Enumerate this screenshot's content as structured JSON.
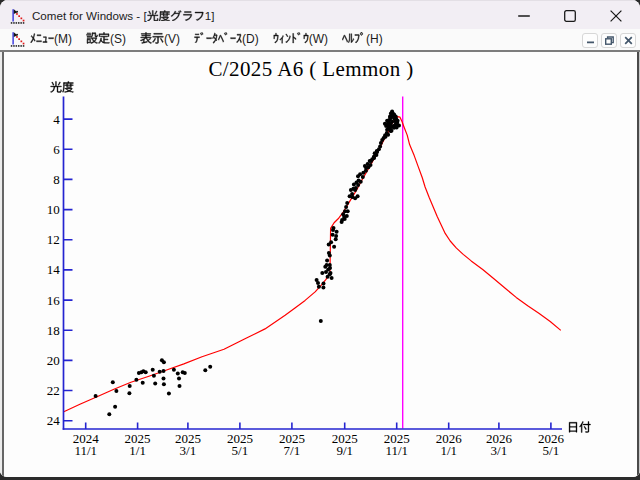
{
  "window": {
    "title": "Comet for Windows - [光度グラフ1]",
    "app_icon": "comet-lightcurve-icon"
  },
  "menu": {
    "items": [
      {
        "id": "menu",
        "label": "ﾒﾆｭｰ(M)"
      },
      {
        "id": "settings",
        "label": "設定(S)"
      },
      {
        "id": "view",
        "label": "表示(V)"
      },
      {
        "id": "database",
        "label": "ﾃﾞｰﾀﾍﾞｰｽ(D)"
      },
      {
        "id": "window",
        "label": "ｳｨﾝﾄﾞｳ(W)"
      },
      {
        "id": "help",
        "label": "ﾍﾙﾌﾟ(H)"
      }
    ]
  },
  "chart_data": {
    "type": "scatter",
    "title": "C/2025 A6 ( Lemmon )",
    "ylabel": "光度",
    "xlabel": "日付",
    "x_epoch": "2024-11-01",
    "xlim_days": [
      -26,
      559
    ],
    "ylim": [
      2.5,
      24.55
    ],
    "y_inverted": true,
    "grid": false,
    "axis_color": "#2424d0",
    "xticks": [
      {
        "day": 0,
        "label": [
          "2024",
          "11/1"
        ]
      },
      {
        "day": 61,
        "label": [
          "2025",
          "1/1"
        ]
      },
      {
        "day": 120,
        "label": [
          "2025",
          "3/1"
        ]
      },
      {
        "day": 181,
        "label": [
          "2025",
          "5/1"
        ]
      },
      {
        "day": 242,
        "label": [
          "2025",
          "7/1"
        ]
      },
      {
        "day": 304,
        "label": [
          "2025",
          "9/1"
        ]
      },
      {
        "day": 365,
        "label": [
          "2025",
          "11/1"
        ]
      },
      {
        "day": 426,
        "label": [
          "2026",
          "1/1"
        ]
      },
      {
        "day": 485,
        "label": [
          "2026",
          "3/1"
        ]
      },
      {
        "day": 546,
        "label": [
          "2026",
          "5/1"
        ]
      }
    ],
    "yticks": [
      4,
      6,
      8,
      10,
      12,
      14,
      16,
      18,
      20,
      22,
      24
    ],
    "perihelion_line": {
      "day": 372,
      "color": "#ff00ff"
    },
    "series": [
      {
        "name": "observations",
        "type": "scatter",
        "color": "#000000",
        "points": [
          [
            11.7,
            22.36
          ],
          [
            27.8,
            23.57
          ],
          [
            31.9,
            21.45
          ],
          [
            34.6,
            23.07
          ],
          [
            36.1,
            22.03
          ],
          [
            51.3,
            22.18
          ],
          [
            51.7,
            21.7
          ],
          [
            59.5,
            21.28
          ],
          [
            62.5,
            20.84
          ],
          [
            65.4,
            20.79
          ],
          [
            66.9,
            21.48
          ],
          [
            67.8,
            20.72
          ],
          [
            70.5,
            20.79
          ],
          [
            78.7,
            20.62
          ],
          [
            80.1,
            21.02
          ],
          [
            81.6,
            21.54
          ],
          [
            86.9,
            20.75
          ],
          [
            89.5,
            19.99
          ],
          [
            91.8,
            20.13
          ],
          [
            91.3,
            20.71
          ],
          [
            91.3,
            21.21
          ],
          [
            91.8,
            21.58
          ],
          [
            97.7,
            22.2
          ],
          [
            103.6,
            20.62
          ],
          [
            108.1,
            20.87
          ],
          [
            109.5,
            21.21
          ],
          [
            110.1,
            21.7
          ],
          [
            113.9,
            20.79
          ],
          [
            116.3,
            20.84
          ],
          [
            140.4,
            20.66
          ],
          [
            146.2,
            20.42
          ],
          [
            275.9,
            17.39
          ],
          [
            271.0,
            14.66
          ],
          [
            273.7,
            15.12
          ],
          [
            277.7,
            14.21
          ],
          [
            279.1,
            14.91
          ],
          [
            279.0,
            15.16
          ],
          [
            281.2,
            13.79
          ],
          [
            282.8,
            13.67
          ],
          [
            283.3,
            13.37
          ],
          [
            283.9,
            14.46
          ],
          [
            284.6,
            13.98
          ],
          [
            286.5,
            13.67
          ],
          [
            286.5,
            14.29
          ],
          [
            286.5,
            13.05
          ],
          [
            285.5,
            12.87
          ],
          [
            287.3,
            14.21
          ],
          [
            288.6,
            14.54
          ],
          [
            285.2,
            12.31
          ],
          [
            288.0,
            12.17
          ],
          [
            289.8,
            11.67
          ],
          [
            290.9,
            11.23
          ],
          [
            291.6,
            12.47
          ],
          [
            293.4,
            11.97
          ],
          [
            294.5,
            11.47
          ],
          [
            300.4,
            10.83
          ],
          [
            302.2,
            10.31
          ],
          [
            304.0,
            10.63
          ],
          [
            306.4,
            10.43
          ],
          [
            307.5,
            10.11
          ],
          [
            304.4,
            10.11
          ],
          [
            305.6,
            9.83
          ],
          [
            306.9,
            9.56
          ],
          [
            309.8,
            9.12
          ],
          [
            313.0,
            9.17
          ],
          [
            316.2,
            9.25
          ],
          [
            319.1,
            9.12
          ],
          [
            311.3,
            8.7
          ],
          [
            314.2,
            8.62
          ],
          [
            317.1,
            8.56
          ],
          [
            314.8,
            8.34
          ],
          [
            317.9,
            8.21
          ],
          [
            320.3,
            8.07
          ],
          [
            322.8,
            8.15
          ],
          [
            319.6,
            7.79
          ],
          [
            322.1,
            7.66
          ],
          [
            325.2,
            7.83
          ],
          [
            325.9,
            7.56
          ],
          [
            328.9,
            7.42
          ],
          [
            327.7,
            7.1
          ],
          [
            330.9,
            6.97
          ],
          [
            331.8,
            7.19
          ],
          [
            334.3,
            7.05
          ],
          [
            333.3,
            6.77
          ],
          [
            336.3,
            6.66
          ],
          [
            338.3,
            6.5
          ],
          [
            339.2,
            6.27
          ],
          [
            341.2,
            6.38
          ],
          [
            341.7,
            6.11
          ],
          [
            344.1,
            6.0
          ],
          [
            345.5,
            5.81
          ],
          [
            346.5,
            5.58
          ],
          [
            348.0,
            5.39
          ],
          [
            349.7,
            5.25
          ],
          [
            351.4,
            5.07
          ],
          [
            353.4,
            4.93
          ],
          [
            357.8,
            4.79
          ],
          [
            351.2,
            4.31
          ],
          [
            353.7,
            4.11
          ],
          [
            355.4,
            4.48
          ],
          [
            357.2,
            3.83
          ],
          [
            357.3,
            4.51
          ],
          [
            358.2,
            3.62
          ],
          [
            358.9,
            4.77
          ],
          [
            359.6,
            3.5
          ],
          [
            359.6,
            4.17
          ],
          [
            360.7,
            3.64
          ],
          [
            361.2,
            4.45
          ],
          [
            361.8,
            4.57
          ],
          [
            362.5,
            3.97
          ],
          [
            363.2,
            4.12
          ],
          [
            364.2,
            4.27
          ],
          [
            365.2,
            4.34
          ],
          [
            366.1,
            4.11
          ],
          [
            367.7,
            4.43
          ],
          [
            356.1,
            4.07
          ],
          [
            358.5,
            3.93
          ],
          [
            360.8,
            3.8
          ],
          [
            364.3,
            3.97
          ],
          [
            365.5,
            4.23
          ],
          [
            357.9,
            4.3
          ],
          [
            354.4,
            4.36
          ],
          [
            362.6,
            4.46
          ],
          [
            364.9,
            4.56
          ],
          [
            359.1,
            4.53
          ],
          [
            356.7,
            4.66
          ],
          [
            353.8,
            4.7
          ],
          [
            351.9,
            5.17
          ],
          [
            354.9,
            5.03
          ],
          [
            300.9,
            10.69
          ],
          [
            303.3,
            10.49
          ],
          [
            312.7,
            8.97
          ],
          [
            316.2,
            8.7
          ],
          [
            319.7,
            8.37
          ],
          [
            329.1,
            7.25
          ],
          [
            335.0,
            6.78
          ],
          [
            338.5,
            6.58
          ],
          [
            342.0,
            6.19
          ],
          [
            290.3,
            11.35
          ],
          [
            293.9,
            11.75
          ],
          [
            286.8,
            13.87
          ],
          [
            282.1,
            14.13
          ],
          [
            272.7,
            14.86
          ],
          [
            359.6,
            3.74
          ],
          [
            362.0,
            3.7
          ],
          [
            357.3,
            3.93
          ],
          [
            354.9,
            4.2
          ],
          [
            352.6,
            4.46
          ],
          [
            363.8,
            3.83
          ]
        ]
      },
      {
        "name": "predicted-light-curve",
        "type": "line",
        "color": "#ff0000",
        "points": [
          [
            -25.6,
            23.4
          ],
          [
            -6.8,
            22.91
          ],
          [
            12.0,
            22.44
          ],
          [
            33.1,
            21.91
          ],
          [
            53.1,
            21.45
          ],
          [
            74.2,
            21.05
          ],
          [
            94.2,
            20.66
          ],
          [
            115.3,
            20.23
          ],
          [
            136.5,
            19.76
          ],
          [
            162.3,
            19.26
          ],
          [
            187.0,
            18.57
          ],
          [
            210.5,
            17.91
          ],
          [
            234.0,
            17.01
          ],
          [
            245.7,
            16.52
          ],
          [
            257.5,
            16.02
          ],
          [
            269.2,
            15.46
          ],
          [
            276.3,
            15.03
          ],
          [
            282.1,
            14.63
          ],
          [
            286.2,
            14.23
          ],
          [
            286.8,
            14.07
          ],
          [
            287.4,
            11.25
          ],
          [
            291.6,
            10.87
          ],
          [
            296.9,
            10.57
          ],
          [
            302.2,
            10.17
          ],
          [
            307.5,
            9.67
          ],
          [
            312.9,
            9.17
          ],
          [
            318.2,
            8.68
          ],
          [
            323.5,
            8.11
          ],
          [
            328.9,
            7.58
          ],
          [
            334.2,
            7.07
          ],
          [
            339.4,
            6.52
          ],
          [
            344.7,
            5.97
          ],
          [
            350.1,
            5.37
          ],
          [
            355.4,
            4.83
          ],
          [
            358.9,
            4.37
          ],
          [
            362.5,
            4.03
          ],
          [
            366.1,
            3.83
          ],
          [
            368.9,
            3.87
          ],
          [
            371.4,
            4.17
          ],
          [
            373.9,
            4.57
          ],
          [
            377.3,
            5.06
          ],
          [
            380.2,
            5.69
          ],
          [
            385.5,
            6.42
          ],
          [
            390.2,
            7.15
          ],
          [
            394.9,
            7.87
          ],
          [
            398.4,
            8.5
          ],
          [
            403.1,
            9.2
          ],
          [
            407.8,
            9.83
          ],
          [
            412.5,
            10.46
          ],
          [
            417.2,
            11.02
          ],
          [
            421.9,
            11.58
          ],
          [
            427.8,
            12.08
          ],
          [
            434.8,
            12.54
          ],
          [
            443.0,
            12.97
          ],
          [
            452.4,
            13.4
          ],
          [
            465.9,
            13.97
          ],
          [
            479.4,
            14.6
          ],
          [
            492.4,
            15.22
          ],
          [
            505.3,
            15.82
          ],
          [
            518.8,
            16.38
          ],
          [
            532.3,
            16.89
          ],
          [
            545.2,
            17.42
          ],
          [
            557.6,
            18.01
          ]
        ]
      }
    ]
  }
}
